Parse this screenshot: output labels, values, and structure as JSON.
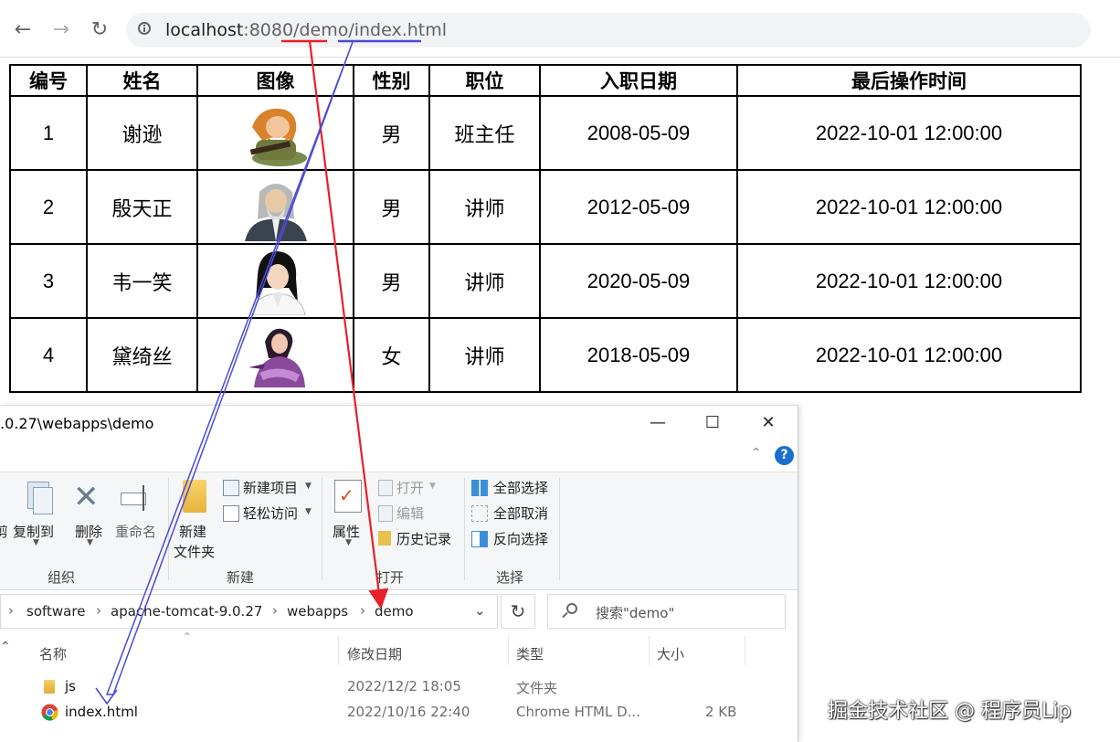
{
  "browser": {
    "url_host": "localhost",
    "url_rest": ":8080/demo/index.html"
  },
  "table": {
    "headers": [
      "编号",
      "姓名",
      "图像",
      "性别",
      "职位",
      "入职日期",
      "最后操作时间"
    ],
    "rows": [
      {
        "id": "1",
        "name": "谢逊",
        "gender": "男",
        "position": "班主任",
        "entry_date": "2008-05-09",
        "last_op": "2022-10-01 12:00:00"
      },
      {
        "id": "2",
        "name": "殷天正",
        "gender": "男",
        "position": "讲师",
        "entry_date": "2012-05-09",
        "last_op": "2022-10-01 12:00:00"
      },
      {
        "id": "3",
        "name": "韦一笑",
        "gender": "男",
        "position": "讲师",
        "entry_date": "2020-05-09",
        "last_op": "2022-10-01 12:00:00"
      },
      {
        "id": "4",
        "name": "黛绮丝",
        "gender": "女",
        "position": "讲师",
        "entry_date": "2018-05-09",
        "last_op": "2022-10-01 12:00:00"
      }
    ]
  },
  "explorer": {
    "title": ".0.27\\webapps\\demo",
    "ribbon": {
      "cut_partial": "剪",
      "copy_to": "复制到",
      "delete": "删除",
      "rename": "重命名",
      "new_folder_line1": "新建",
      "new_folder_line2": "文件夹",
      "new_item": "新建项目",
      "easy_access": "轻松访问",
      "properties": "属性",
      "open": "打开",
      "edit": "编辑",
      "history": "历史记录",
      "select_all": "全部选择",
      "select_none": "全部取消",
      "invert_selection": "反向选择",
      "group_organize": "组织",
      "group_new": "新建",
      "group_open": "打开",
      "group_select": "选择"
    },
    "breadcrumb": [
      "software",
      "apache-tomcat-9.0.27",
      "webapps",
      "demo"
    ],
    "search_placeholder": "搜索\"demo\"",
    "columns": {
      "name": "名称",
      "modified": "修改日期",
      "type": "类型",
      "size": "大小"
    },
    "files": [
      {
        "name": "js",
        "modified": "2022/12/2 18:05",
        "type": "文件夹",
        "size": ""
      },
      {
        "name": "index.html",
        "modified": "2022/10/16 22:40",
        "type": "Chrome HTML D...",
        "size": "2 KB"
      }
    ]
  },
  "watermark": "掘金技术社区 @ 程序员Lip",
  "colors": {
    "red_arrow": "#e8202a",
    "blue_arrow": "#4b4bd8",
    "chrome_red": "#db4437",
    "folder_yellow": "#f0c24a"
  }
}
